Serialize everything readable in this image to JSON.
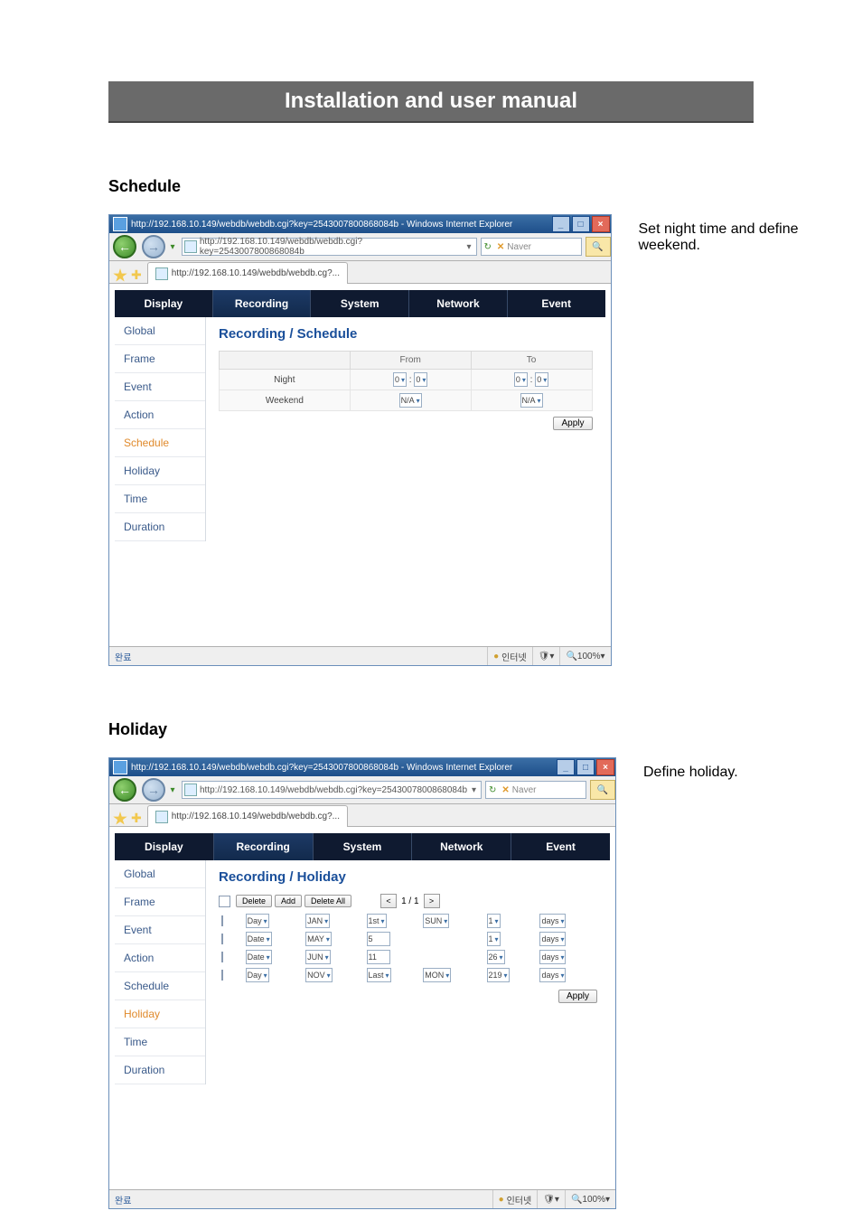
{
  "banner": "Installation and user manual",
  "sections": {
    "schedule": {
      "heading": "Schedule",
      "caption": "Set night time and define weekend."
    },
    "holiday": {
      "heading": "Holiday",
      "caption": "Define holiday."
    }
  },
  "ie_common": {
    "title": "http://192.168.10.149/webdb/webdb.cgi?key=2543007800868084b - Windows Internet Explorer",
    "address_full": "http://192.168.10.149/webdb/webdb.cgi?key=2543007800868084b",
    "tab_label": "http://192.168.10.149/webdb/webdb.cg?...",
    "search_placeholder": "Naver",
    "status_center": "인터넷",
    "zoom": "100%",
    "win": {
      "min": "_",
      "max": "□",
      "close": "×"
    }
  },
  "maintabs": [
    "Display",
    "Recording",
    "System",
    "Network",
    "Event"
  ],
  "maintab_selected": "Recording",
  "sidebar_items": [
    "Global",
    "Frame",
    "Event",
    "Action",
    "Schedule",
    "Holiday",
    "Time",
    "Duration"
  ],
  "schedule_view": {
    "selected_side": "Schedule",
    "title": "Recording / Schedule",
    "cols": [
      "",
      "From",
      "To"
    ],
    "rows": [
      {
        "label": "Night",
        "from": [
          "0",
          "0"
        ],
        "to": [
          "0",
          "0"
        ]
      },
      {
        "label": "Weekend",
        "from_single": "N/A",
        "to_single": "N/A"
      }
    ],
    "apply": "Apply"
  },
  "holiday_view": {
    "selected_side": "Holiday",
    "title": "Recording / Holiday",
    "buttons": {
      "delete": "Delete",
      "add": "Add",
      "delete_all": "Delete All"
    },
    "pager": {
      "prev": "<",
      "text": "1 / 1",
      "next": ">"
    },
    "rows": [
      {
        "mode": "Day",
        "m": "JAN",
        "d": "1st",
        "wd": "SUN",
        "n": "1",
        "dur": "days"
      },
      {
        "mode": "Date",
        "m": "MAY",
        "d": "5",
        "n": "1",
        "dur": "days"
      },
      {
        "mode": "Date",
        "m": "JUN",
        "d": "11",
        "n": "26",
        "dur": "days"
      },
      {
        "mode": "Day",
        "m": "NOV",
        "d": "Last",
        "wd": "MON",
        "n": "219",
        "dur": "days"
      }
    ],
    "apply": "Apply"
  }
}
